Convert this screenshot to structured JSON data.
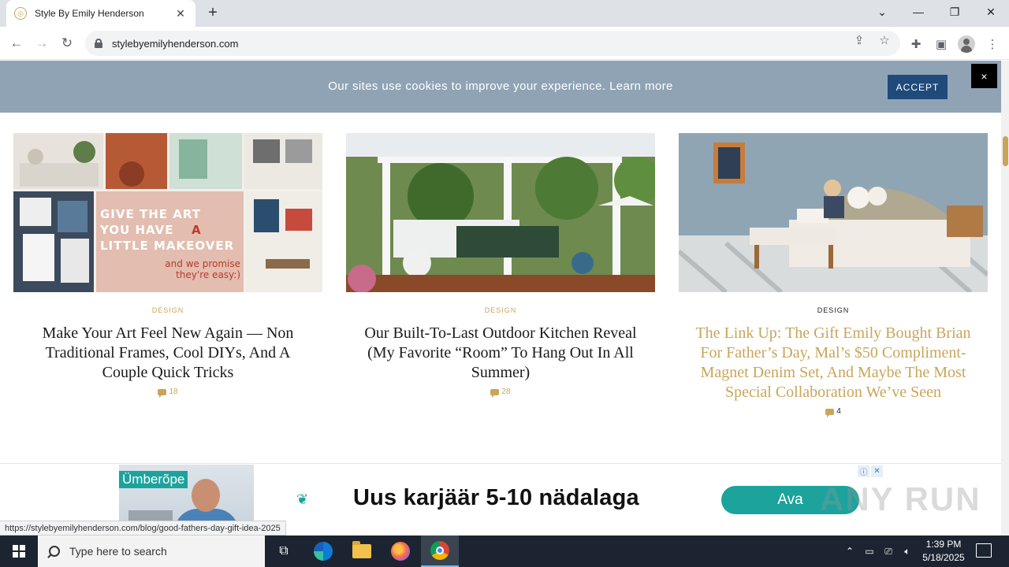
{
  "browser": {
    "tab_title": "Style By Emily Henderson",
    "url": "stylebyemilyhenderson.com",
    "status_url": "https://stylebyemilyhenderson.com/blog/good-fathers-day-gift-idea-2025"
  },
  "cookie": {
    "message": "Our sites use cookies to improve your experience.",
    "learn_more": "Learn more",
    "accept_label": "ACCEPT",
    "close_label": "×"
  },
  "cards": [
    {
      "category": "DESIGN",
      "title": "Make Your Art Feel New Again — Non Traditional Frames, Cool DIYs, And A Couple Quick Tricks",
      "comments": "18",
      "image_text": [
        "GIVE THE ART",
        "YOU HAVE",
        "A",
        "LITTLE MAKEOVER",
        "and we promise",
        "they're easy:)"
      ]
    },
    {
      "category": "DESIGN",
      "title": "Our Built-To-Last Outdoor Kitchen Reveal (My Favorite “Room” To Hang Out In All Summer)",
      "comments": "28"
    },
    {
      "category": "DESIGN",
      "title": "The Link Up: The Gift Emily Bought Brian For Father’s Day, Mal’s $50 Compliment-Magnet Denim Set, And Maybe The Most Special Collaboration We’ve Seen",
      "comments": "4"
    }
  ],
  "ad": {
    "brand": "Ümberõpe",
    "headline": "Uus karjäär 5-10 nädalaga",
    "cta": "Ava",
    "watermark": "ANY RUN"
  },
  "taskbar": {
    "search_placeholder": "Type here to search",
    "time": "1:39 PM",
    "date": "5/18/2025"
  },
  "colors": {
    "accent_gold": "#c9a55a",
    "cookie_bar": "#8fa3b5",
    "accept_button": "#1f4a7a",
    "ad_teal": "#1ba39c"
  }
}
